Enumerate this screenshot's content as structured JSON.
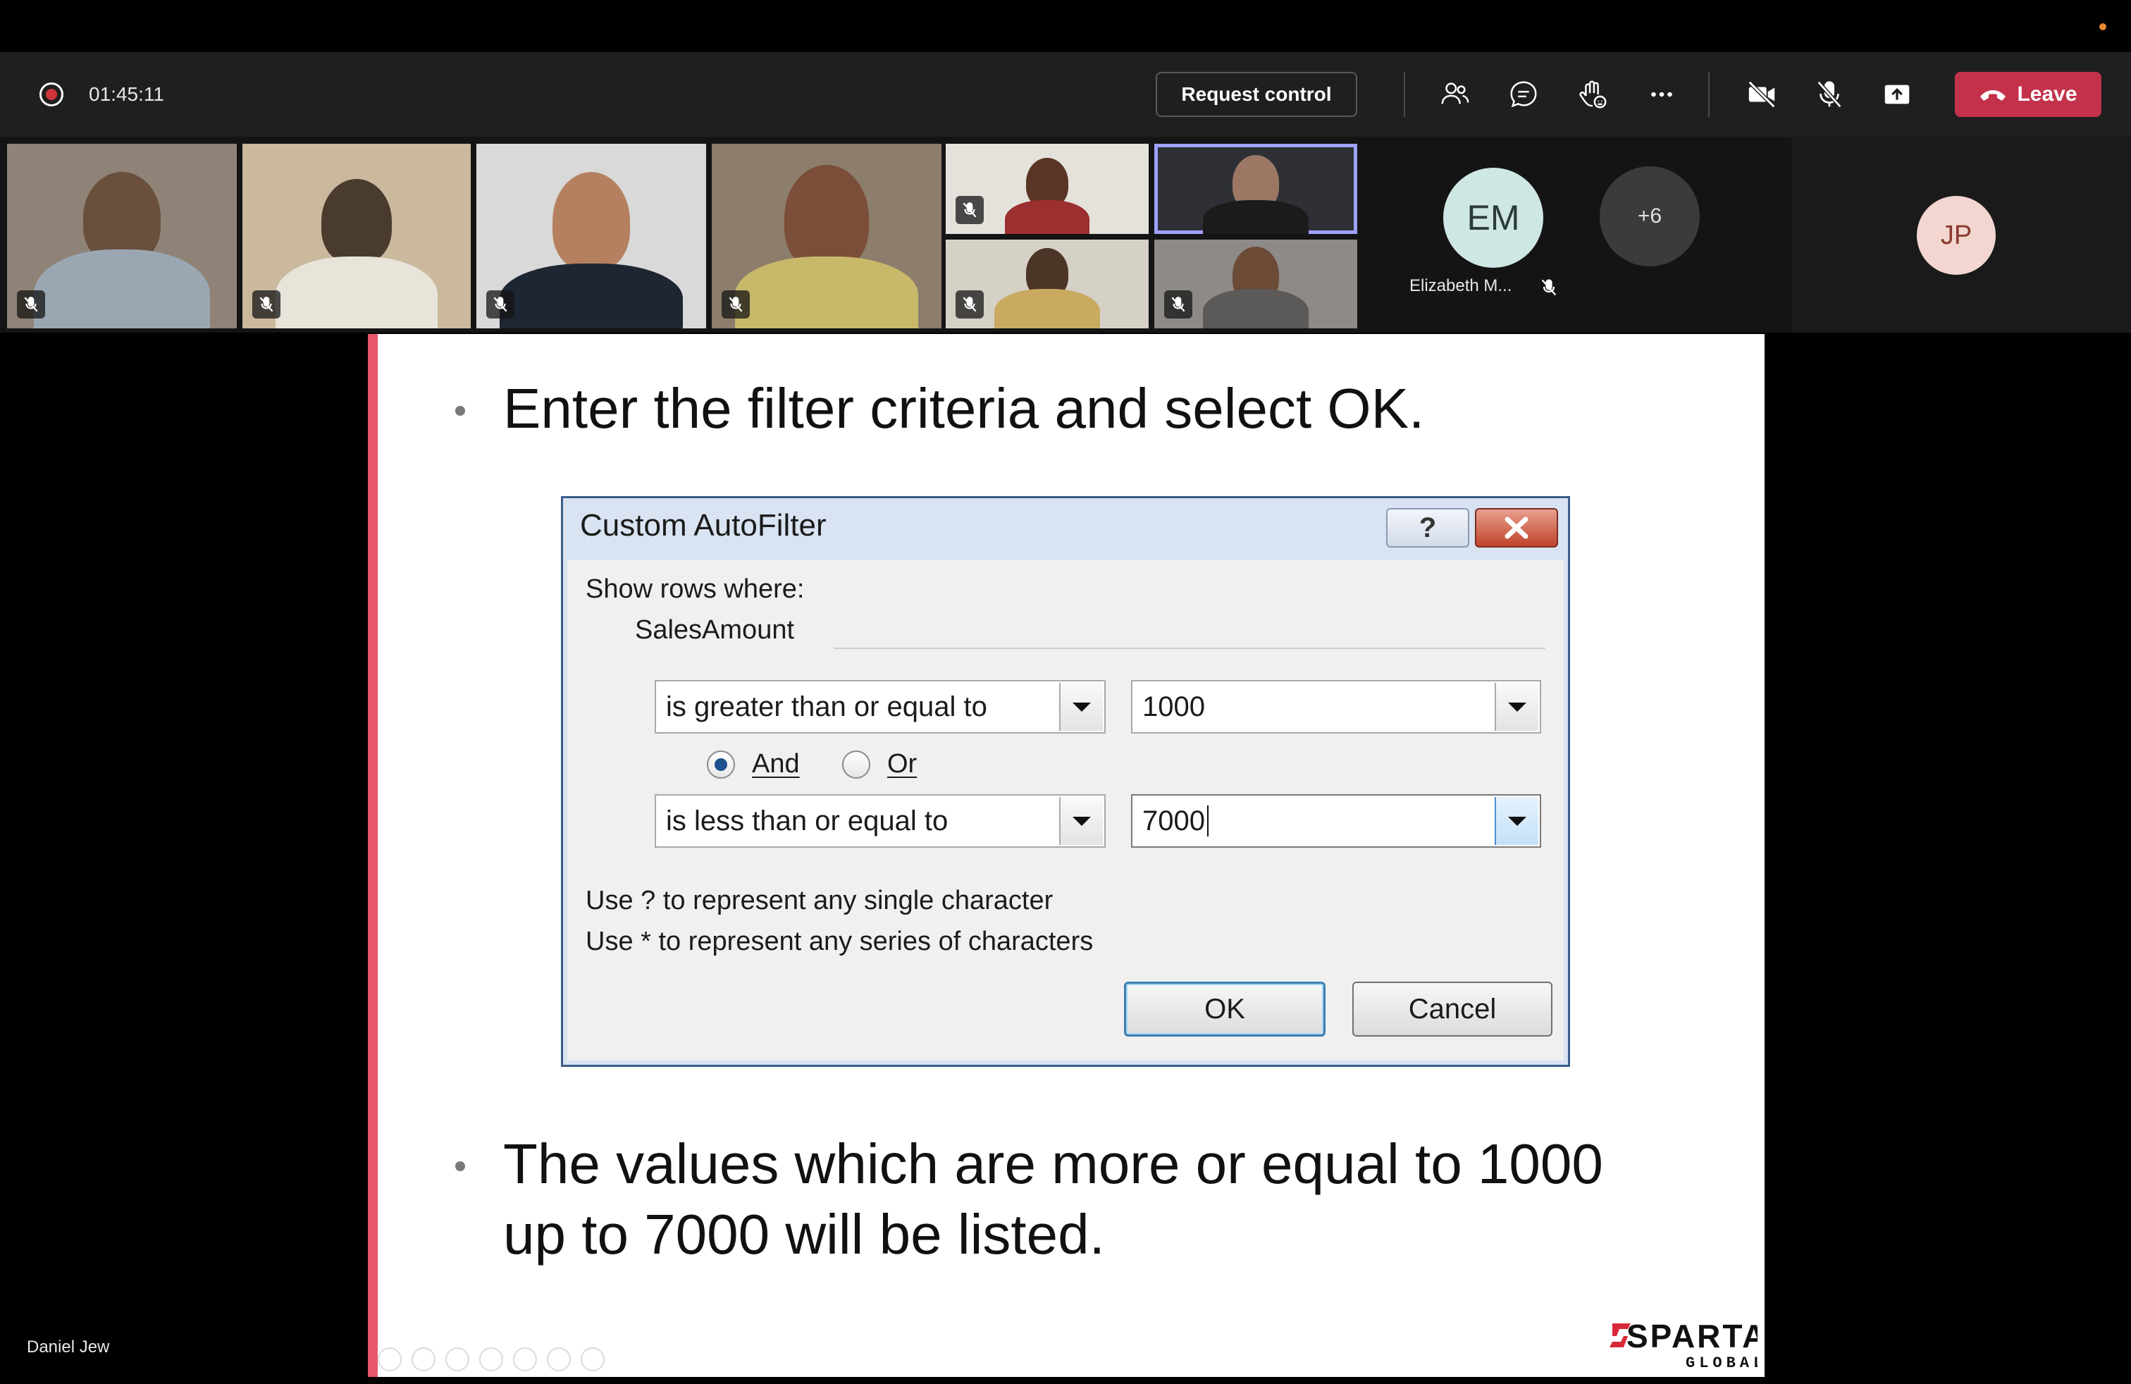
{
  "meeting": {
    "timer": "01:45:11",
    "request_control_label": "Request control",
    "leave_label": "Leave",
    "colors": {
      "leave": "#c4314b",
      "recording": "#d13438",
      "selected_tile": "#9ea2ff"
    }
  },
  "toolbar_icons": [
    "people-icon",
    "chat-icon",
    "raise-hand-icon",
    "more-options-icon",
    "camera-off-icon",
    "mic-off-icon",
    "share-tray-icon"
  ],
  "participants": {
    "video_tiles_count": 8,
    "em": {
      "initials": "EM",
      "name": "Elizabeth M..."
    },
    "overflow": "+6",
    "self": {
      "initials": "JP"
    }
  },
  "presenter": {
    "name": "Daniel Jew"
  },
  "slide": {
    "bullet1": "Enter the filter criteria and select OK.",
    "bullet2_line1": "The values which are more or equal to 1000",
    "bullet2_line2": "up to 7000 will be listed.",
    "logo_main": "SPARTA",
    "logo_sub": "GLOBAL",
    "accent_color": "#e8566a"
  },
  "dialog": {
    "title": "Custom AutoFilter",
    "help_label": "?",
    "show_rows": "Show rows where:",
    "field": "SalesAmount",
    "op1": "is greater than or equal to",
    "val1": "1000",
    "and_label": "And",
    "or_label": "Or",
    "logic_selected": "And",
    "op2": "is less than or equal to",
    "val2": "7000",
    "hint1": "Use ? to represent any single character",
    "hint2": "Use * to represent any series of characters",
    "ok_label": "OK",
    "cancel_label": "Cancel"
  }
}
